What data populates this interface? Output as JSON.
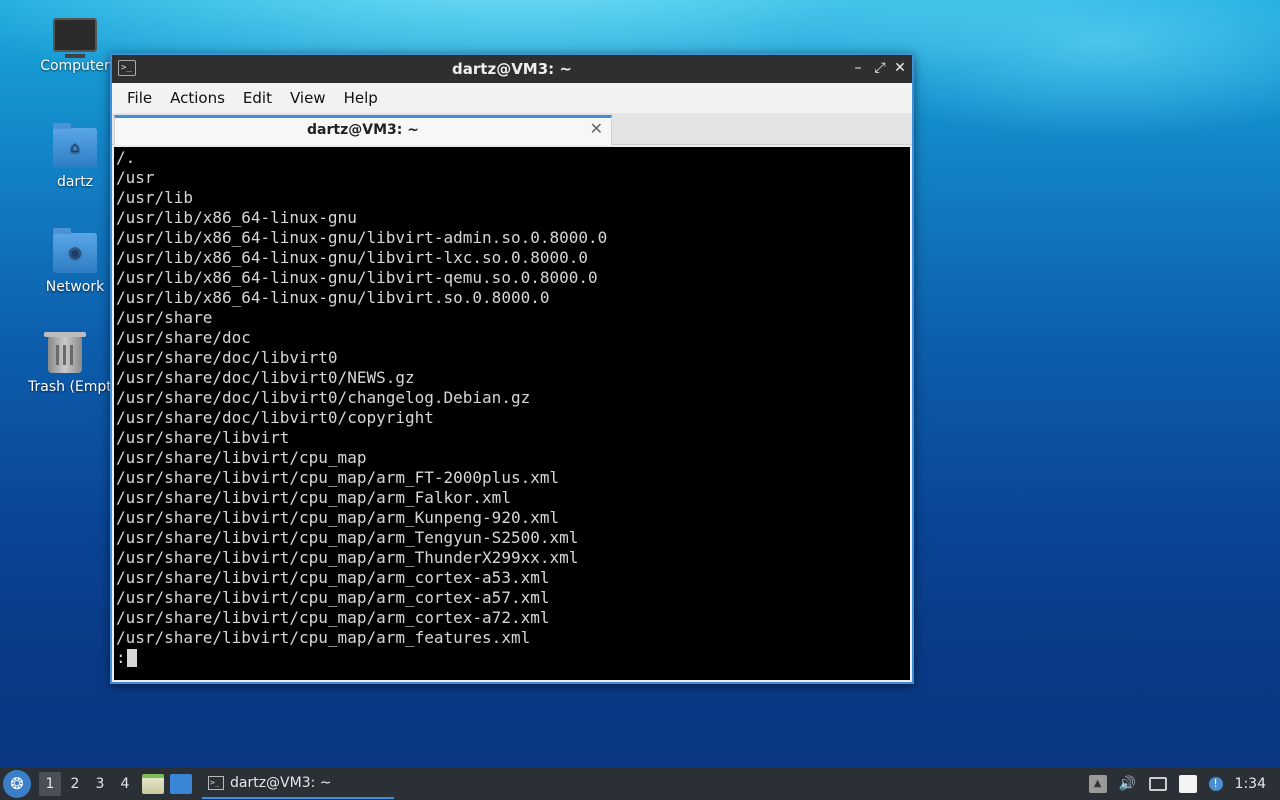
{
  "desktop": {
    "icons": [
      {
        "label": "Computer"
      },
      {
        "label": "dartz",
        "glyph": "⌂"
      },
      {
        "label": "Network",
        "glyph": "◉"
      },
      {
        "label": "Trash (Empty)"
      }
    ]
  },
  "window": {
    "title": "dartz@VM3: ~",
    "buttons": {
      "minimize": "–",
      "maximize": "⤢",
      "close": "✕"
    },
    "menu": [
      "File",
      "Actions",
      "Edit",
      "View",
      "Help"
    ],
    "tab": {
      "title": "dartz@VM3: ~",
      "close": "✕"
    },
    "terminal": {
      "lines": [
        "/.",
        "/usr",
        "/usr/lib",
        "/usr/lib/x86_64-linux-gnu",
        "/usr/lib/x86_64-linux-gnu/libvirt-admin.so.0.8000.0",
        "/usr/lib/x86_64-linux-gnu/libvirt-lxc.so.0.8000.0",
        "/usr/lib/x86_64-linux-gnu/libvirt-qemu.so.0.8000.0",
        "/usr/lib/x86_64-linux-gnu/libvirt.so.0.8000.0",
        "/usr/share",
        "/usr/share/doc",
        "/usr/share/doc/libvirt0",
        "/usr/share/doc/libvirt0/NEWS.gz",
        "/usr/share/doc/libvirt0/changelog.Debian.gz",
        "/usr/share/doc/libvirt0/copyright",
        "/usr/share/libvirt",
        "/usr/share/libvirt/cpu_map",
        "/usr/share/libvirt/cpu_map/arm_FT-2000plus.xml",
        "/usr/share/libvirt/cpu_map/arm_Falkor.xml",
        "/usr/share/libvirt/cpu_map/arm_Kunpeng-920.xml",
        "/usr/share/libvirt/cpu_map/arm_Tengyun-S2500.xml",
        "/usr/share/libvirt/cpu_map/arm_ThunderX299xx.xml",
        "/usr/share/libvirt/cpu_map/arm_cortex-a53.xml",
        "/usr/share/libvirt/cpu_map/arm_cortex-a57.xml",
        "/usr/share/libvirt/cpu_map/arm_cortex-a72.xml",
        "/usr/share/libvirt/cpu_map/arm_features.xml"
      ],
      "prompt": ":"
    }
  },
  "taskbar": {
    "start_glyph": "❂",
    "workspaces": [
      "1",
      "2",
      "3",
      "4"
    ],
    "active_workspace": "1",
    "task": {
      "label": "dartz@VM3: ~"
    },
    "tray": {
      "up_arrow": "▲",
      "volume": "🔊",
      "update_badge": "!"
    },
    "clock": "1:34"
  },
  "colors": {
    "accent": "#3c8fd8",
    "terminal_bg": "#000000",
    "terminal_fg": "#d6d6d6",
    "taskbar_bg": "#2b2f36"
  }
}
